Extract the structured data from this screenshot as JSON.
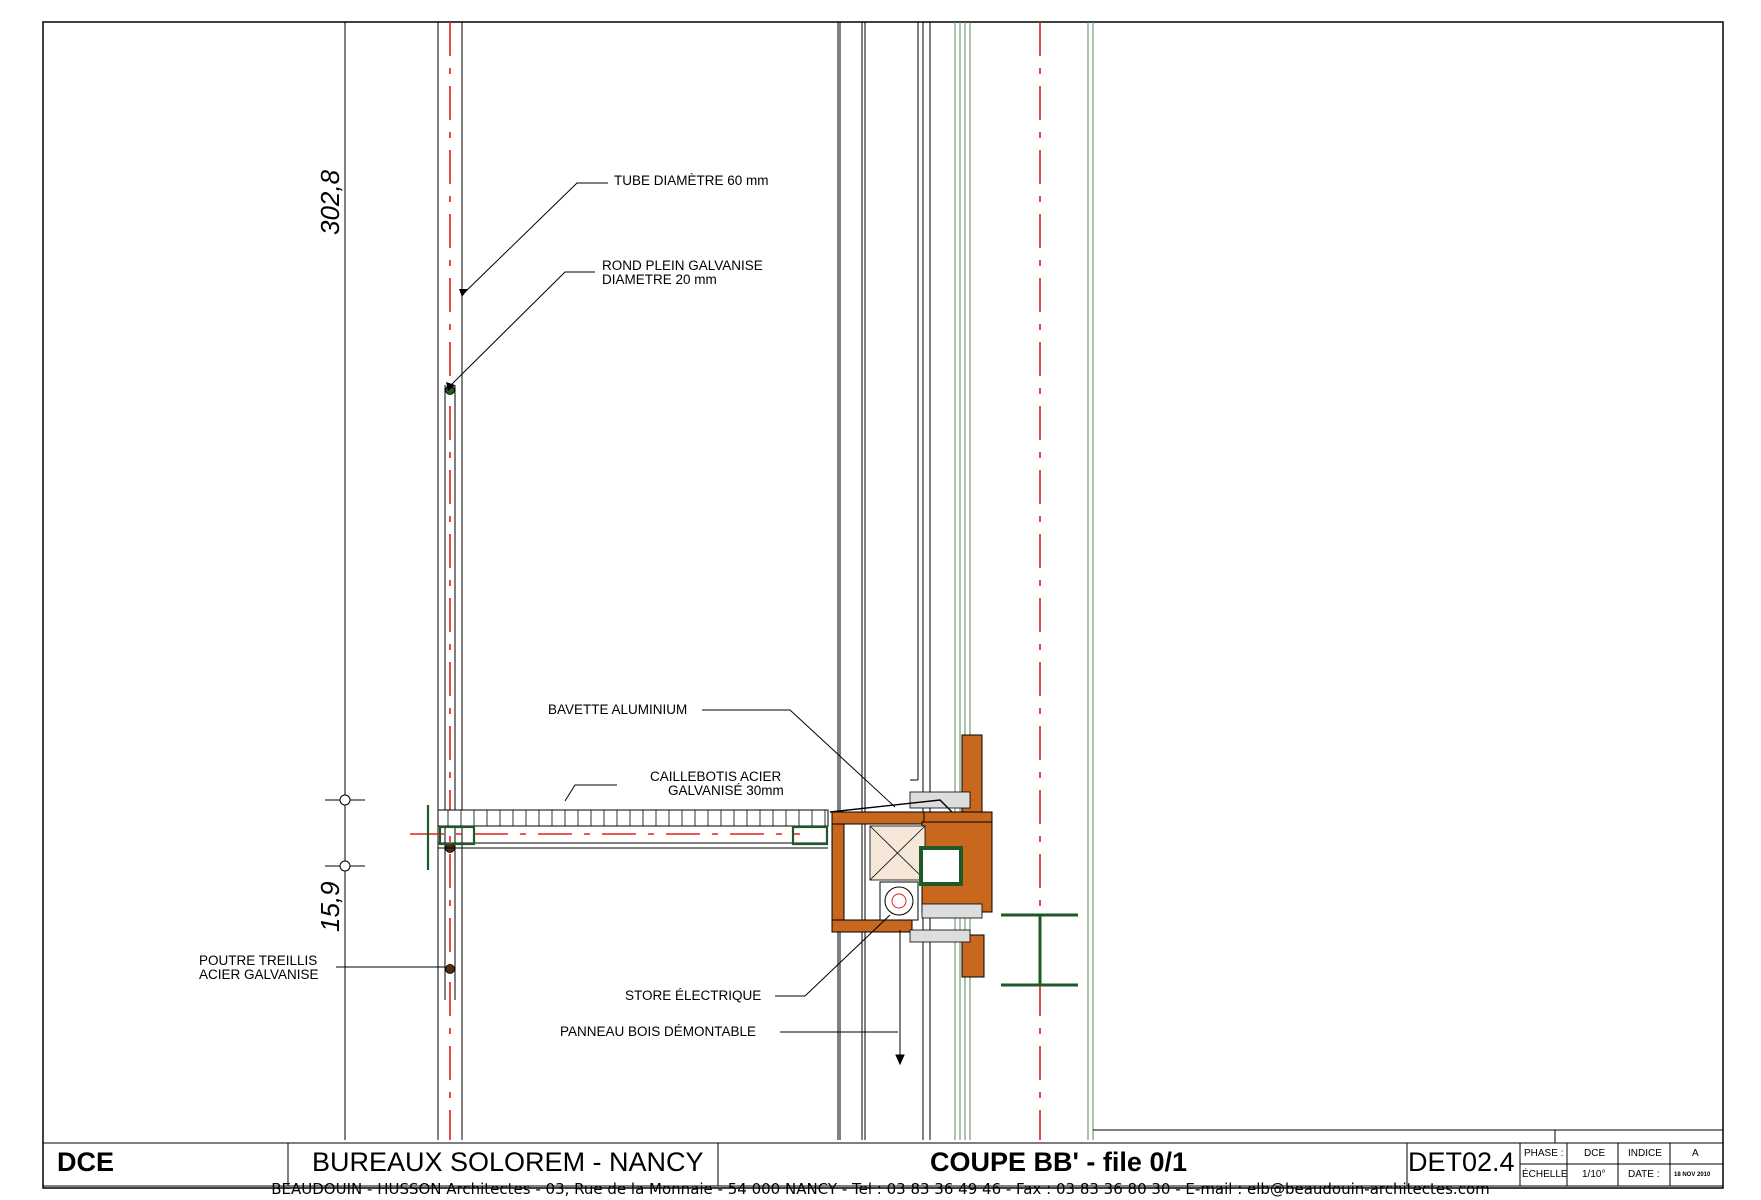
{
  "annotations": {
    "tube": "TUBE DIAMÈTRE 60 mm",
    "rond_line1": "ROND PLEIN GALVANISE",
    "rond_line2": "DIAMETRE 20 mm",
    "bavette": "BAVETTE ALUMINIUM",
    "caillebotis_line1": "CAILLEBOTIS ACIER",
    "caillebotis_line2": "GALVANISÉ 30mm",
    "poutre_line1": "POUTRE TREILLIS",
    "poutre_line2": "ACIER GALVANISE",
    "store": "STORE ÉLECTRIQUE",
    "panneau": "PANNEAU BOIS DÉMONTABLE"
  },
  "dimensions": {
    "upper": "302,8",
    "lower": "15,9"
  },
  "title_block": {
    "phase_code": "DCE",
    "project": "BUREAUX SOLOREM - NANCY",
    "drawing_title": "COUPE BB' - file 0/1",
    "drawing_number": "DET02.4",
    "phase_label": "PHASE :",
    "phase_value": "DCE",
    "indice_label": "INDICE",
    "indice_value": "A",
    "echelle_label": "ÉCHELLE",
    "echelle_value": "1/10°",
    "date_label": "DATE :",
    "date_value": "18 NOV 2010"
  },
  "footer": "BEAUDOUIN - HUSSON  Architectes - 03, Rue de la Monnaie - 54 000  NANCY - Tel : 03 83 36 49 46 - Fax : 03 83 36 80 30 - E-mail : elb@beaudouin-architectes.com",
  "colors": {
    "axis_red": "#e0201c",
    "wood": "#c8681e",
    "steel_green": "#1e5a28"
  }
}
